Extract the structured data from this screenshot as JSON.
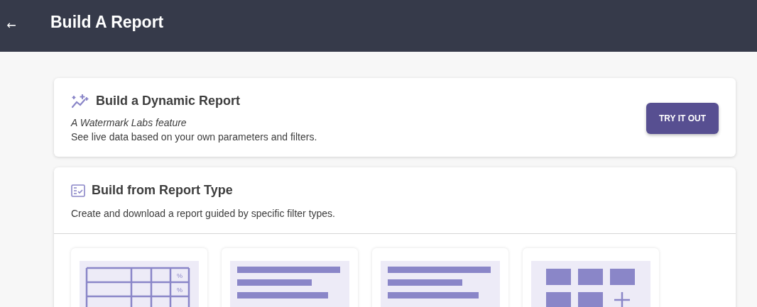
{
  "header": {
    "back_icon": "←",
    "title": "Build A Report"
  },
  "dynamic_report": {
    "title": "Build a Dynamic Report",
    "tagline": "A Watermark Labs feature",
    "description": "See live data based on your own parameters and filters.",
    "button": "TRY IT OUT"
  },
  "report_type": {
    "title": "Build from Report Type",
    "description": "Create and download a report guided by specific filter types.",
    "cards": [
      {
        "kind": "table",
        "percent_marks": [
          "%",
          "%"
        ]
      },
      {
        "kind": "lines"
      },
      {
        "kind": "lines"
      },
      {
        "kind": "tiles"
      }
    ]
  }
}
